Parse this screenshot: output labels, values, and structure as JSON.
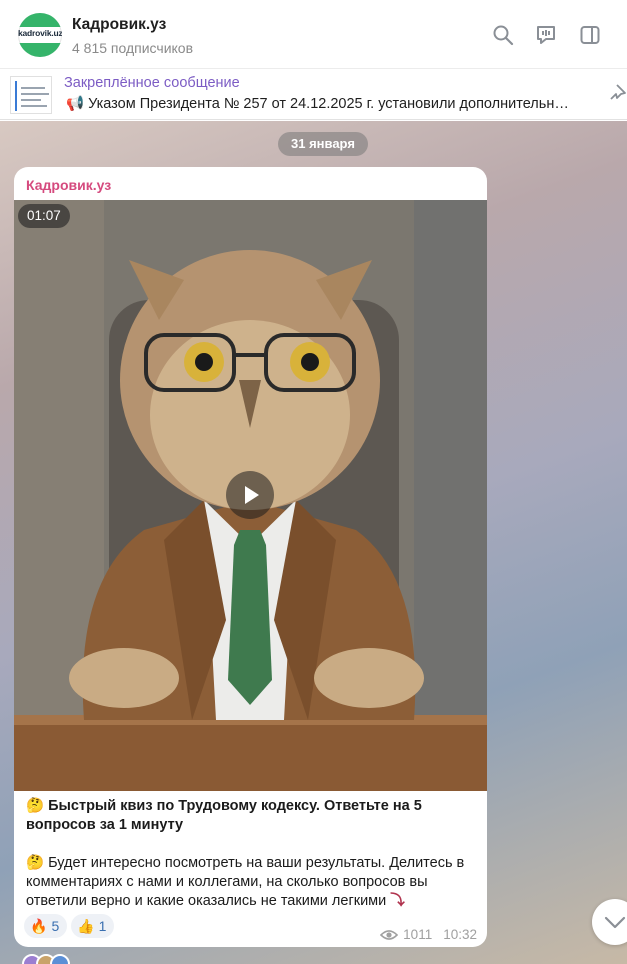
{
  "header": {
    "avatar_text": "kadrovik.uz",
    "title": "Кадровик.уз",
    "subscribers": "4 815 подписчиков",
    "icons": [
      "search-icon",
      "live-chat-icon",
      "sidebar-toggle-icon"
    ]
  },
  "pinned": {
    "title": "Закреплённое сообщение",
    "emoji": "📢",
    "text": "Указом Президента № 257 от 24.12.2025 г. установили дополнительн…"
  },
  "chat": {
    "date": "31 января",
    "message": {
      "sender": "Кадровик.уз",
      "video_duration": "01:07",
      "caption_line1_emoji": "🤔",
      "caption_title": "Быстрый квиз по Трудовому кодексу. Ответьте на 5 вопросов за 1 минуту",
      "caption_body_emoji": "🤔",
      "caption_body": "Будет интересно посмотреть на ваши результаты. Делитесь в комментариях с нами и коллегами, на сколько вопросов вы ответили верно и какие оказались не такими легкими",
      "caption_body_end_emoji": "⤵",
      "reactions": [
        {
          "emoji": "🔥",
          "count": "5"
        },
        {
          "emoji": "👍",
          "count": "1"
        }
      ],
      "views": "1011",
      "time": "10:32"
    }
  },
  "colors": {
    "sender": "#d54a7e",
    "pinned_title": "#7c5cc4",
    "avatar_green": "#35b46a",
    "reaction_text": "#3a6fb0"
  }
}
